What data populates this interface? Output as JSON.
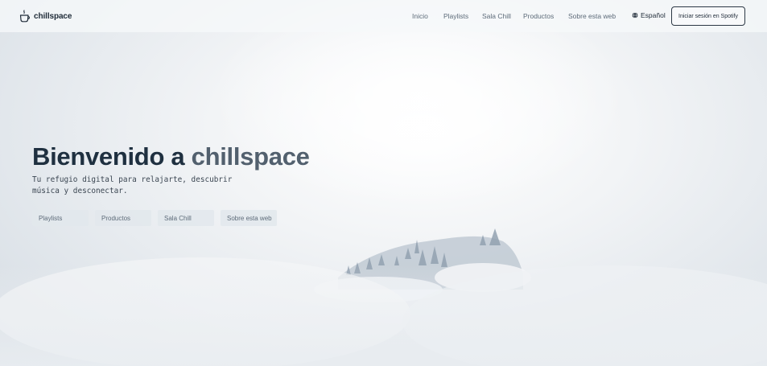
{
  "header": {
    "brand_name": "chillspace",
    "nav": [
      {
        "label": "Inicio"
      },
      {
        "label": "Playlists"
      },
      {
        "label": "Sala Chill"
      },
      {
        "label": "Productos"
      },
      {
        "label": "Sobre esta web"
      }
    ],
    "language": "Español",
    "login_label": "Iniciar sesión en Spotify"
  },
  "hero": {
    "title_prefix": "Bienvenido a ",
    "title_accent": "chillspace",
    "subtitle": "Tu refugio digital para relajarte, descubrir música y desconectar.",
    "buttons": [
      {
        "label": "Playlists"
      },
      {
        "label": "Productos"
      },
      {
        "label": "Sala Chill"
      },
      {
        "label": "Sobre esta web"
      }
    ]
  },
  "icons": {
    "brand": "coffee-cup-icon",
    "language": "globe-icon"
  },
  "colors": {
    "title": "#1f3040",
    "title_accent": "#52606e",
    "nav_text": "#5d6b79",
    "button_bg": "#e2e7ec"
  }
}
